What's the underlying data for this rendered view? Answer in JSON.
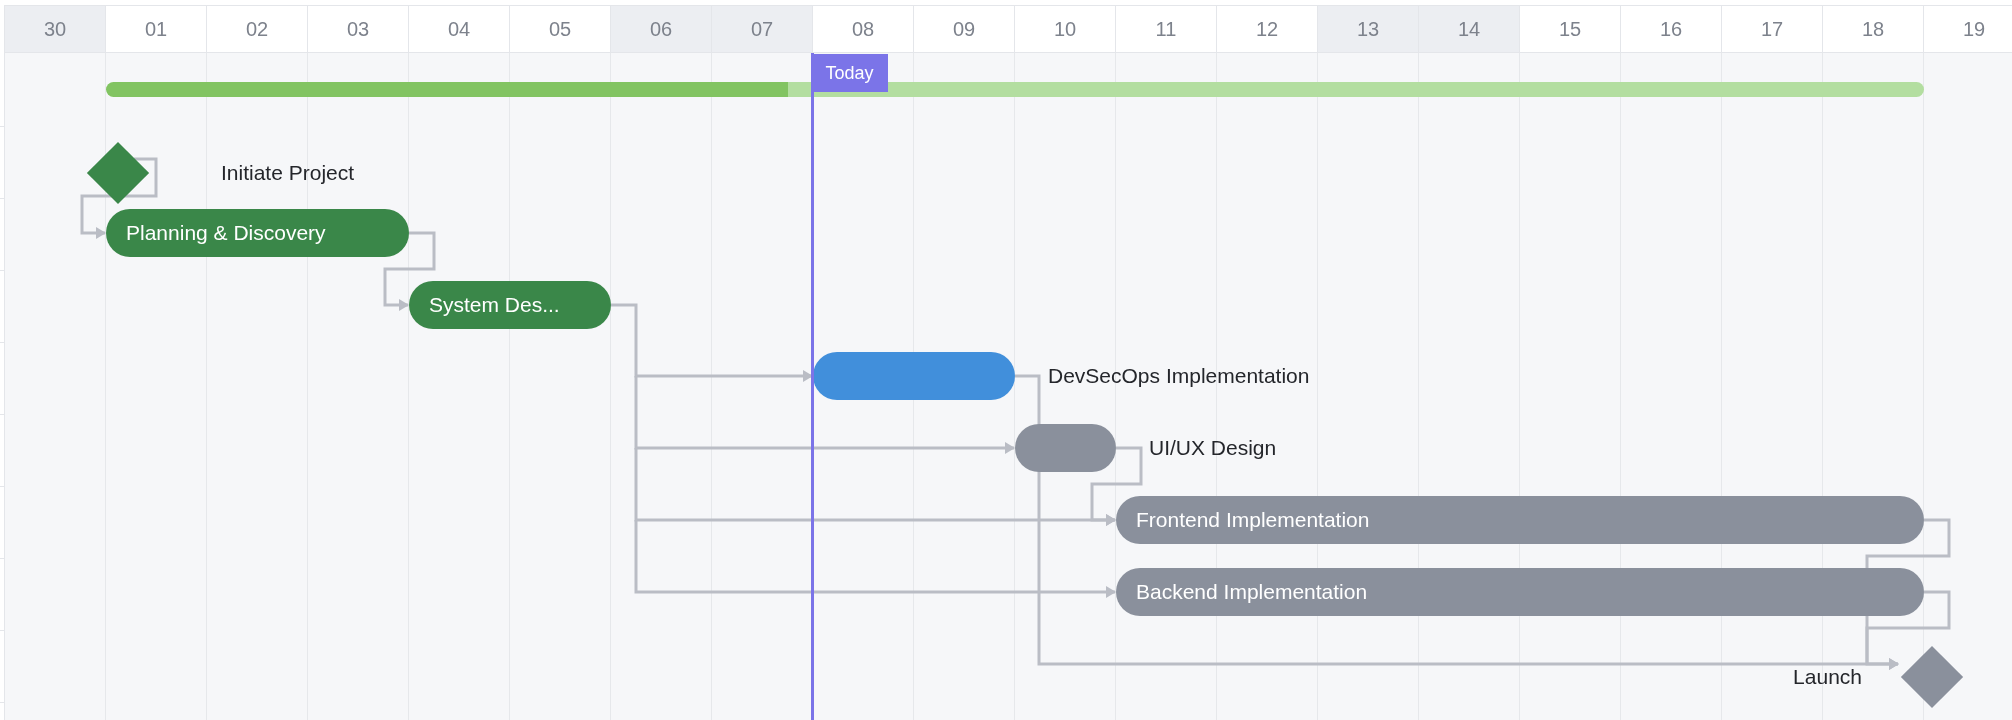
{
  "days": [
    {
      "label": "30",
      "weekend": true
    },
    {
      "label": "01",
      "weekend": false
    },
    {
      "label": "02",
      "weekend": false
    },
    {
      "label": "03",
      "weekend": false
    },
    {
      "label": "04",
      "weekend": false
    },
    {
      "label": "05",
      "weekend": false
    },
    {
      "label": "06",
      "weekend": true
    },
    {
      "label": "07",
      "weekend": true
    },
    {
      "label": "08",
      "weekend": false
    },
    {
      "label": "09",
      "weekend": false
    },
    {
      "label": "10",
      "weekend": false
    },
    {
      "label": "11",
      "weekend": false
    },
    {
      "label": "12",
      "weekend": false
    },
    {
      "label": "13",
      "weekend": true
    },
    {
      "label": "14",
      "weekend": true
    },
    {
      "label": "15",
      "weekend": false
    },
    {
      "label": "16",
      "weekend": false
    },
    {
      "label": "17",
      "weekend": false
    },
    {
      "label": "18",
      "weekend": false
    },
    {
      "label": "19",
      "weekend": false
    }
  ],
  "today": {
    "label": "Today"
  },
  "progress": {
    "level": 0.375
  },
  "tasks": [
    {
      "kind": "milestone",
      "label": "Initiate Project",
      "color": "#3a8749"
    },
    {
      "kind": "bar",
      "label": "Planning & Discovery",
      "color": "#3a8749"
    },
    {
      "kind": "bar",
      "label": "System Des...",
      "color": "#3a8749"
    },
    {
      "kind": "bar",
      "label": "DevSecOps Implementation",
      "color": "#418fdb"
    },
    {
      "kind": "bar",
      "label": "UI/UX Design",
      "color": "#8a909c"
    },
    {
      "kind": "bar",
      "label": "Frontend Implementation",
      "color": "#8a909c"
    },
    {
      "kind": "bar",
      "label": "Backend Implementation",
      "color": "#8a909c"
    },
    {
      "kind": "milestone",
      "label": "Launch",
      "color": "#8a909c"
    }
  ]
}
